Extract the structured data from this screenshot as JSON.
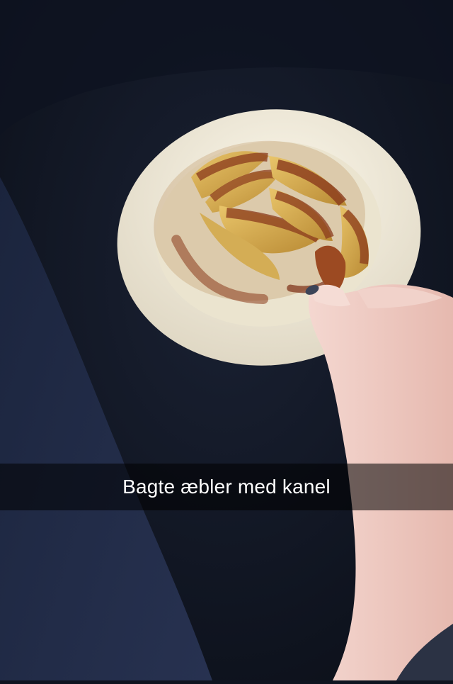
{
  "snap": {
    "caption": "Bagte æbler med kanel"
  },
  "colors": {
    "background": "#0f1420",
    "plate": "#f1ecdd",
    "apple": "#d9b45a",
    "cinnamon": "#8a3a1c",
    "skin": "#f0cfc8"
  }
}
